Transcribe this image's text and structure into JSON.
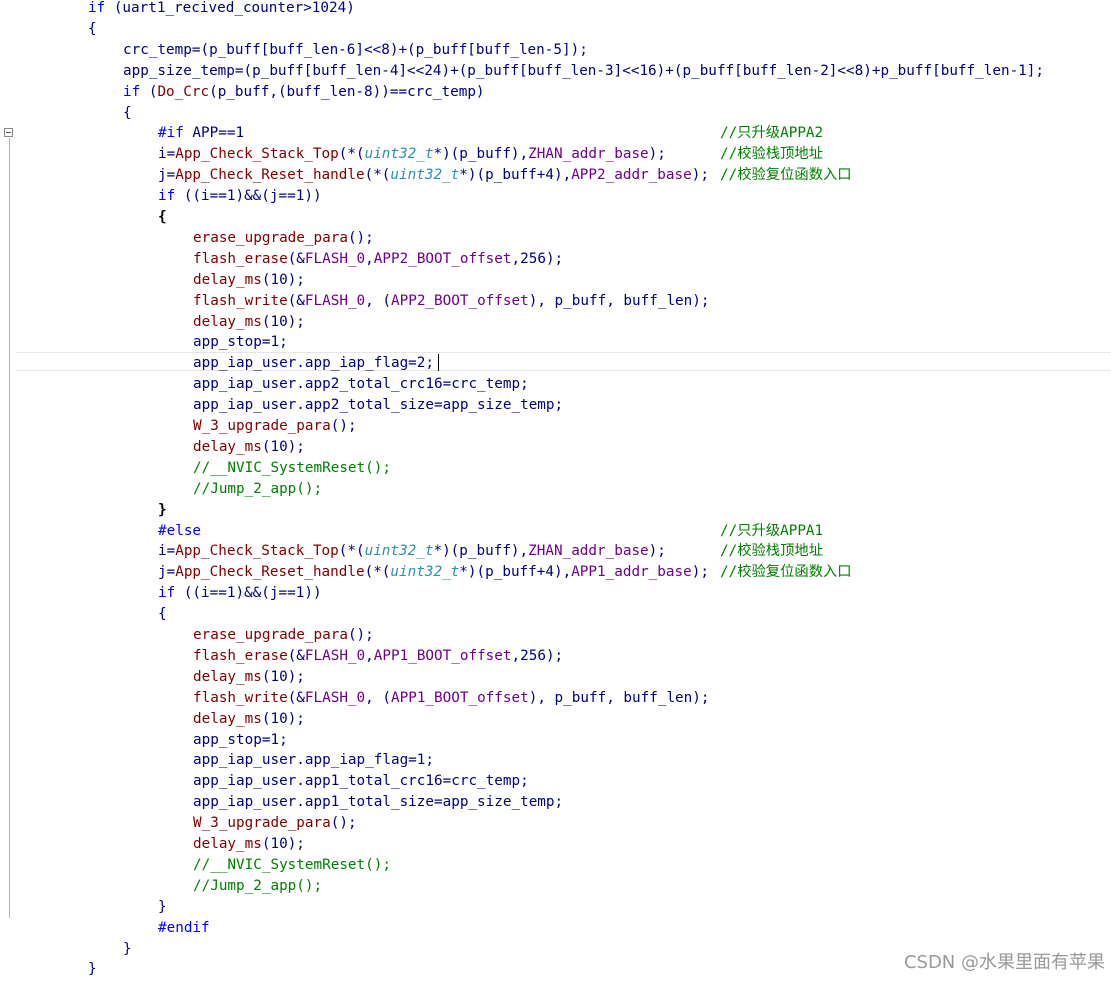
{
  "colors": {
    "keyword": "#0000ff",
    "identifier": "#000080",
    "function": "#800000",
    "macro": "#6f008a",
    "type": "#2b91af",
    "comment": "#008000",
    "brace": "#000000"
  },
  "watermark": "CSDN @水果里面有苹果",
  "lines": [
    [
      [
        "if",
        0
      ],
      [
        " (uart1_recived_counter>1024)",
        1
      ]
    ],
    [
      [
        "{",
        1
      ]
    ],
    [
      [
        "crc_temp=(p_buff[buff_len-6]<<8)+(p_buff[buff_len-5]);",
        1
      ]
    ],
    [
      [
        "app_size_temp=(p_buff[buff_len-4]<<24)+(p_buff[buff_len-3]<<16)+(p_buff[buff_len-2]<<8)+p_buff[buff_len-1];",
        1
      ]
    ],
    [
      [
        "if",
        0
      ],
      [
        " (",
        1
      ],
      [
        "Do_Crc",
        2
      ],
      [
        "(p_buff,(buff_len-8))==crc_temp)",
        1
      ]
    ],
    [
      [
        "{",
        1
      ]
    ],
    [
      [
        "#if",
        0
      ],
      [
        " APP==1",
        1
      ],
      [
        "//只升级APPA2",
        5
      ]
    ],
    [
      [
        "i=",
        1
      ],
      [
        "App_Check_Stack_Top",
        2
      ],
      [
        "(*(",
        1
      ],
      [
        "uint32_t",
        4
      ],
      [
        "*)(p_buff),",
        1
      ],
      [
        "ZHAN_addr_base",
        3
      ],
      [
        ");",
        1
      ],
      [
        "//校验栈顶地址",
        5
      ]
    ],
    [
      [
        "j=",
        1
      ],
      [
        "App_Check_Reset_handle",
        2
      ],
      [
        "(*(",
        1
      ],
      [
        "uint32_t",
        4
      ],
      [
        "*)(p_buff+4),",
        1
      ],
      [
        "APP2_addr_base",
        3
      ],
      [
        ");",
        1
      ],
      [
        "//校验复位函数入口",
        5
      ]
    ],
    [
      [
        "if",
        0
      ],
      [
        " ((i==1)&&(j==1))",
        1
      ]
    ],
    [
      [
        "{",
        6
      ]
    ],
    [
      [
        "erase_upgrade_para",
        2
      ],
      [
        "();",
        1
      ]
    ],
    [
      [
        "flash_erase",
        2
      ],
      [
        "(&",
        1
      ],
      [
        "FLASH_0",
        3
      ],
      [
        ",",
        1
      ],
      [
        "APP2_BOOT_offset",
        3
      ],
      [
        ",256);",
        1
      ]
    ],
    [
      [
        "delay_ms",
        2
      ],
      [
        "(10);",
        1
      ]
    ],
    [
      [
        "flash_write",
        2
      ],
      [
        "(&",
        1
      ],
      [
        "FLASH_0",
        3
      ],
      [
        ", (",
        1
      ],
      [
        "APP2_BOOT_offset",
        3
      ],
      [
        "), p_buff, buff_len);",
        1
      ]
    ],
    [
      [
        "delay_ms",
        2
      ],
      [
        "(10);",
        1
      ]
    ],
    [
      [
        "app_stop=1;",
        1
      ]
    ],
    [
      [
        "app_iap_user.app_iap_flag=2;",
        1
      ]
    ],
    [
      [
        "app_iap_user.app2_total_crc16=crc_temp;",
        1
      ]
    ],
    [
      [
        "app_iap_user.app2_total_size=app_size_temp;",
        1
      ]
    ],
    [
      [
        "W_3_upgrade_para",
        2
      ],
      [
        "();",
        1
      ]
    ],
    [
      [
        "delay_ms",
        2
      ],
      [
        "(10);",
        1
      ]
    ],
    [
      [
        "//__NVIC_SystemReset();",
        5
      ]
    ],
    [
      [
        "//Jump_2_app();",
        5
      ]
    ],
    [
      [
        "}",
        6
      ]
    ],
    [
      [
        "#else",
        0
      ],
      [
        "//只升级APPA1",
        5
      ]
    ],
    [
      [
        "i=",
        1
      ],
      [
        "App_Check_Stack_Top",
        2
      ],
      [
        "(*(",
        1
      ],
      [
        "uint32_t",
        4
      ],
      [
        "*)(p_buff),",
        1
      ],
      [
        "ZHAN_addr_base",
        3
      ],
      [
        ");",
        1
      ],
      [
        "//校验栈顶地址",
        5
      ]
    ],
    [
      [
        "j=",
        1
      ],
      [
        "App_Check_Reset_handle",
        2
      ],
      [
        "(*(",
        1
      ],
      [
        "uint32_t",
        4
      ],
      [
        "*)(p_buff+4),",
        1
      ],
      [
        "APP1_addr_base",
        3
      ],
      [
        ");",
        1
      ],
      [
        "//校验复位函数入口",
        5
      ]
    ],
    [
      [
        "if",
        0
      ],
      [
        " ((i==1)&&(j==1))",
        1
      ]
    ],
    [
      [
        "{",
        1
      ]
    ],
    [
      [
        "erase_upgrade_para",
        2
      ],
      [
        "();",
        1
      ]
    ],
    [
      [
        "flash_erase",
        2
      ],
      [
        "(&",
        1
      ],
      [
        "FLASH_0",
        3
      ],
      [
        ",",
        1
      ],
      [
        "APP1_BOOT_offset",
        3
      ],
      [
        ",256);",
        1
      ]
    ],
    [
      [
        "delay_ms",
        2
      ],
      [
        "(10);",
        1
      ]
    ],
    [
      [
        "flash_write",
        2
      ],
      [
        "(&",
        1
      ],
      [
        "FLASH_0",
        3
      ],
      [
        ", (",
        1
      ],
      [
        "APP1_BOOT_offset",
        3
      ],
      [
        "), p_buff, buff_len);",
        1
      ]
    ],
    [
      [
        "delay_ms",
        2
      ],
      [
        "(10);",
        1
      ]
    ],
    [
      [
        "app_stop=1;",
        1
      ]
    ],
    [
      [
        "app_iap_user.app_iap_flag=1;",
        1
      ]
    ],
    [
      [
        "app_iap_user.app1_total_crc16=crc_temp;",
        1
      ]
    ],
    [
      [
        "app_iap_user.app1_total_size=app_size_temp;",
        1
      ]
    ],
    [
      [
        "W_3_upgrade_para",
        2
      ],
      [
        "();",
        1
      ]
    ],
    [
      [
        "delay_ms",
        2
      ],
      [
        "(10);",
        1
      ]
    ],
    [
      [
        "//__NVIC_SystemReset();",
        5
      ]
    ],
    [
      [
        "//Jump_2_app();",
        5
      ]
    ],
    [
      [
        "}",
        1
      ]
    ],
    [
      [
        "#endif",
        0
      ]
    ],
    [
      [
        "}",
        1
      ]
    ],
    [
      [
        "}",
        1
      ]
    ]
  ]
}
